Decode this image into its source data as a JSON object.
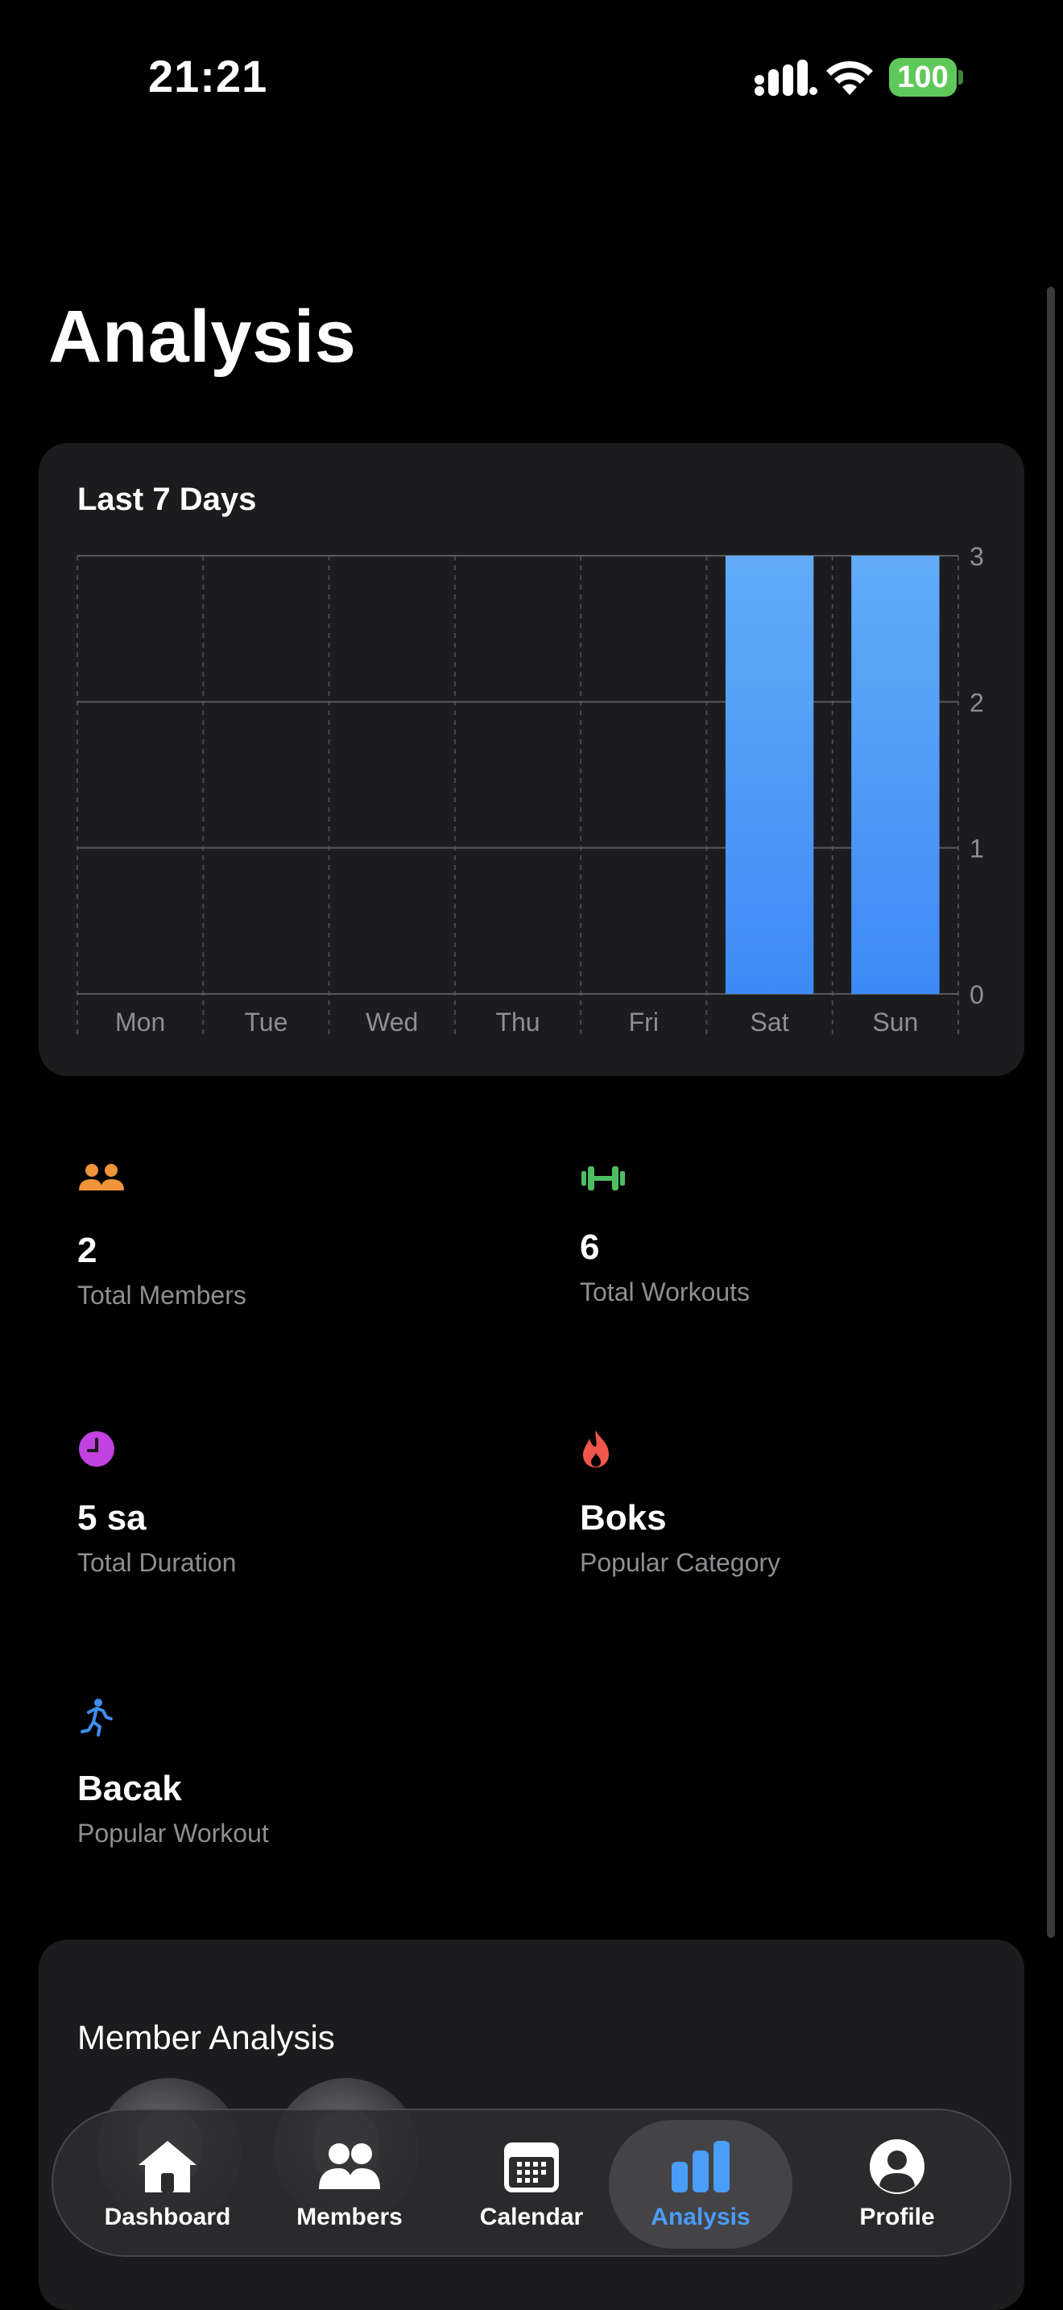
{
  "status": {
    "time": "21:21",
    "battery": "100"
  },
  "page": {
    "title": "Analysis"
  },
  "chart_card": {
    "title": "Last 7 Days"
  },
  "chart_data": {
    "type": "bar",
    "categories": [
      "Mon",
      "Tue",
      "Wed",
      "Thu",
      "Fri",
      "Sat",
      "Sun"
    ],
    "values": [
      0,
      0,
      0,
      0,
      0,
      3,
      3
    ],
    "yticks": [
      "0",
      "1",
      "2",
      "3"
    ],
    "ylim": [
      0,
      3
    ],
    "grid": true,
    "bar_color": "#3d8af5",
    "bar_color_top": "#62abf8"
  },
  "stats": {
    "members": {
      "value": "2",
      "label": "Total Members",
      "color": "#f0943a"
    },
    "workouts": {
      "value": "6",
      "label": "Total Workouts",
      "color": "#4dbf63"
    },
    "duration": {
      "value": "5 sa",
      "label": "Total Duration",
      "color": "#c142e0"
    },
    "category": {
      "value": "Boks",
      "label": "Popular Category",
      "color": "#f0564b"
    },
    "workout": {
      "value": "Bacak",
      "label": "Popular Workout",
      "color": "#3f8ef3"
    }
  },
  "member_analysis": {
    "title": "Member Analysis"
  },
  "tabs": [
    {
      "label": "Dashboard",
      "icon": "house-icon"
    },
    {
      "label": "Members",
      "icon": "people-icon"
    },
    {
      "label": "Calendar",
      "icon": "calendar-icon"
    },
    {
      "label": "Analysis",
      "icon": "chart-icon",
      "active": true
    },
    {
      "label": "Profile",
      "icon": "person-circle-icon"
    }
  ],
  "colors": {
    "accent": "#4a9df8",
    "card": "#1c1c1e",
    "secondary_text": "#8e8e93"
  }
}
